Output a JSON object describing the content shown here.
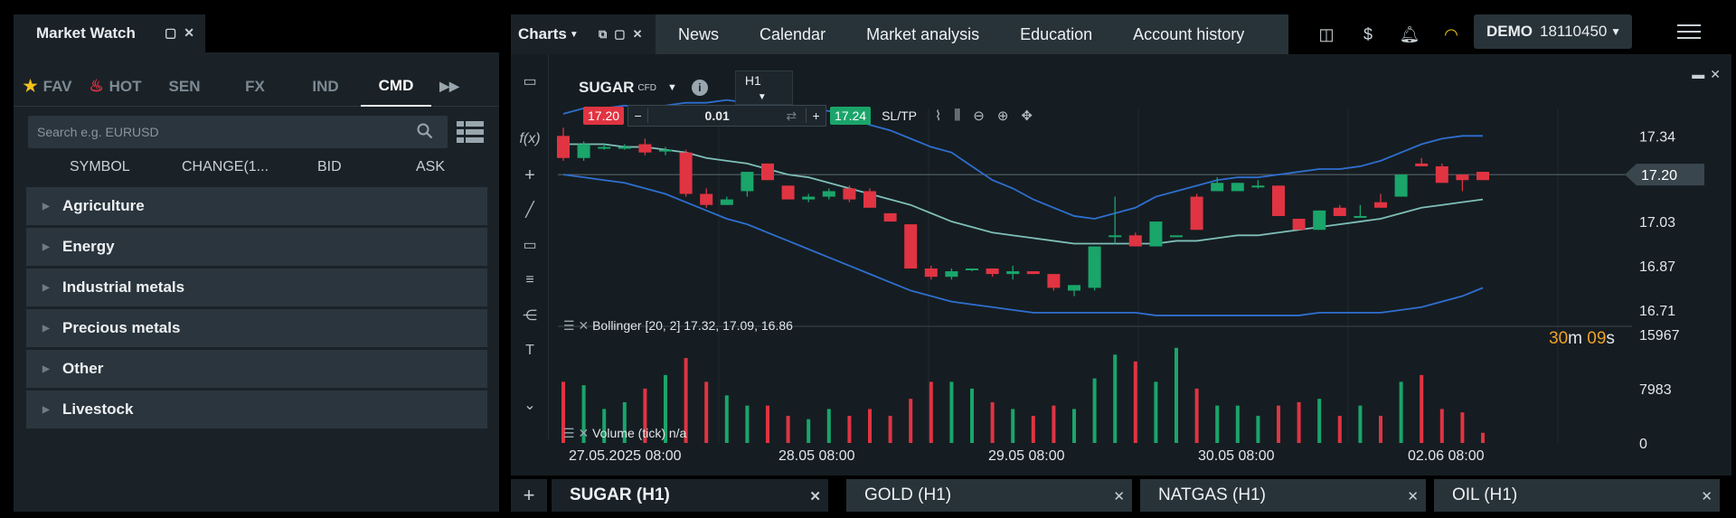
{
  "market_watch": {
    "title": "Market Watch",
    "tabs": [
      {
        "label": "FAV",
        "icon": "star-icon"
      },
      {
        "label": "HOT",
        "icon": "flame-icon"
      },
      {
        "label": "SEN"
      },
      {
        "label": "FX"
      },
      {
        "label": "IND"
      },
      {
        "label": "CMD",
        "active": true
      }
    ],
    "search_placeholder": "Search e.g. EURUSD",
    "columns": [
      "SYMBOL",
      "CHANGE(1...",
      "BID",
      "ASK"
    ],
    "groups": [
      "Agriculture",
      "Energy",
      "Industrial metals",
      "Precious metals",
      "Other",
      "Livestock"
    ]
  },
  "charts": {
    "tab_label": "Charts",
    "nav": [
      "News",
      "Calendar",
      "Market analysis",
      "Education",
      "Account history"
    ],
    "account": {
      "type": "DEMO",
      "number": "18110450"
    },
    "symbol": "SUGAR",
    "symbol_type": "CFD",
    "timeframe": "H1",
    "sell_price": "17.20",
    "buy_price": "17.24",
    "volume": "0.01",
    "sltp_label": "SL/TP",
    "bollinger_label": "Bollinger [20, 2] 17.32, 17.09, 16.86",
    "volume_label": "Volume (tick) n/a",
    "timer": {
      "min": "30",
      "m": "m",
      "sec": "09",
      "s": "s"
    },
    "current_price": "17.20",
    "colors": {
      "bull": "#1aa56a",
      "bear": "#e03442",
      "bb_outer": "#2f6fd0",
      "bb_mid": "#7fbfb8",
      "timer": "#f0a128"
    }
  },
  "chart_data": {
    "type": "candlestick",
    "price_axis_ticks": [
      "17.34",
      "17.20",
      "17.03",
      "16.87",
      "16.71"
    ],
    "volume_axis_ticks": [
      "15967",
      "7983",
      "0"
    ],
    "x_tick_labels": [
      "27.05.2025 08:00",
      "28.05 08:00",
      "29.05 08:00",
      "30.05 08:00",
      "02.06 08:00"
    ],
    "candles": [
      [
        17.34,
        17.37,
        17.25,
        17.26
      ],
      [
        17.26,
        17.32,
        17.25,
        17.31
      ],
      [
        17.3,
        17.31,
        17.29,
        17.3
      ],
      [
        17.3,
        17.31,
        17.29,
        17.3
      ],
      [
        17.31,
        17.33,
        17.27,
        17.28
      ],
      [
        17.29,
        17.3,
        17.27,
        17.29
      ],
      [
        17.28,
        17.29,
        17.12,
        17.13
      ],
      [
        17.13,
        17.15,
        17.08,
        17.09
      ],
      [
        17.09,
        17.12,
        17.09,
        17.11
      ],
      [
        17.14,
        17.21,
        17.12,
        17.21
      ],
      [
        17.24,
        17.24,
        17.18,
        17.18
      ],
      [
        17.16,
        17.16,
        17.11,
        17.11
      ],
      [
        17.11,
        17.13,
        17.1,
        17.12
      ],
      [
        17.12,
        17.15,
        17.11,
        17.14
      ],
      [
        17.15,
        17.16,
        17.1,
        17.11
      ],
      [
        17.14,
        17.15,
        17.08,
        17.08
      ],
      [
        17.06,
        17.06,
        17.03,
        17.03
      ],
      [
        17.02,
        17.02,
        16.86,
        16.86
      ],
      [
        16.86,
        16.87,
        16.82,
        16.83
      ],
      [
        16.83,
        16.86,
        16.82,
        16.85
      ],
      [
        16.86,
        16.86,
        16.85,
        16.86
      ],
      [
        16.86,
        16.86,
        16.83,
        16.84
      ],
      [
        16.84,
        16.87,
        16.82,
        16.85
      ],
      [
        16.85,
        16.85,
        16.84,
        16.84
      ],
      [
        16.84,
        16.84,
        16.78,
        16.79
      ],
      [
        16.78,
        16.8,
        16.76,
        16.8
      ],
      [
        16.79,
        16.94,
        16.78,
        16.94
      ],
      [
        16.98,
        17.12,
        16.95,
        16.98
      ],
      [
        16.98,
        16.99,
        16.94,
        16.94
      ],
      [
        16.94,
        17.03,
        16.94,
        17.03
      ],
      [
        16.98,
        16.98,
        16.98,
        16.98
      ],
      [
        17.12,
        17.13,
        17.0,
        17.0
      ],
      [
        17.14,
        17.19,
        17.14,
        17.17
      ],
      [
        17.14,
        17.17,
        17.14,
        17.17
      ],
      [
        17.16,
        17.18,
        17.15,
        17.16
      ],
      [
        17.16,
        17.16,
        17.05,
        17.05
      ],
      [
        17.04,
        17.04,
        17.0,
        17.0
      ],
      [
        17.0,
        17.07,
        17.0,
        17.07
      ],
      [
        17.08,
        17.09,
        17.05,
        17.05
      ],
      [
        17.05,
        17.09,
        17.05,
        17.05
      ],
      [
        17.1,
        17.13,
        17.08,
        17.08
      ],
      [
        17.12,
        17.2,
        17.12,
        17.2
      ],
      [
        17.24,
        17.26,
        17.23,
        17.23
      ],
      [
        17.23,
        17.24,
        17.17,
        17.17
      ],
      [
        17.2,
        17.2,
        17.14,
        17.18
      ],
      [
        17.21,
        17.21,
        17.18,
        17.18
      ]
    ],
    "volume": [
      9000,
      8500,
      5000,
      6000,
      8000,
      10000,
      12500,
      9000,
      7000,
      5500,
      5500,
      4000,
      3500,
      5000,
      4000,
      5000,
      4000,
      6500,
      9000,
      9000,
      8000,
      6000,
      5000,
      4000,
      5500,
      5000,
      9500,
      13000,
      12000,
      9000,
      14000,
      8000,
      5500,
      5500,
      4000,
      5500,
      6000,
      6500,
      4000,
      5500,
      4000,
      9000,
      10000,
      5000,
      4500,
      1500
    ],
    "bb_upper": [
      17.42,
      17.44,
      17.44,
      17.45,
      17.44,
      17.45,
      17.46,
      17.46,
      17.47,
      17.46,
      17.46,
      17.45,
      17.44,
      17.43,
      17.41,
      17.38,
      17.36,
      17.33,
      17.3,
      17.28,
      17.23,
      17.18,
      17.15,
      17.11,
      17.08,
      17.05,
      17.04,
      17.06,
      17.08,
      17.12,
      17.14,
      17.16,
      17.18,
      17.19,
      17.19,
      17.2,
      17.21,
      17.22,
      17.22,
      17.23,
      17.25,
      17.28,
      17.31,
      17.33,
      17.34,
      17.34
    ],
    "bb_mid": [
      17.31,
      17.31,
      17.31,
      17.3,
      17.3,
      17.29,
      17.28,
      17.26,
      17.25,
      17.24,
      17.22,
      17.2,
      17.19,
      17.17,
      17.15,
      17.13,
      17.11,
      17.09,
      17.06,
      17.03,
      17.01,
      16.99,
      16.98,
      16.97,
      16.96,
      16.95,
      16.95,
      16.95,
      16.95,
      16.95,
      16.96,
      16.96,
      16.97,
      16.98,
      16.98,
      16.99,
      17.0,
      17.01,
      17.02,
      17.03,
      17.04,
      17.06,
      17.08,
      17.09,
      17.1,
      17.11
    ],
    "bb_lower": [
      17.2,
      17.19,
      17.18,
      17.17,
      17.15,
      17.13,
      17.1,
      17.07,
      17.04,
      17.02,
      16.99,
      16.96,
      16.93,
      16.9,
      16.87,
      16.84,
      16.81,
      16.78,
      16.76,
      16.74,
      16.73,
      16.72,
      16.71,
      16.7,
      16.7,
      16.7,
      16.7,
      16.7,
      16.7,
      16.69,
      16.69,
      16.69,
      16.69,
      16.69,
      16.69,
      16.69,
      16.69,
      16.7,
      16.7,
      16.7,
      16.7,
      16.71,
      16.72,
      16.74,
      16.76,
      16.79
    ]
  },
  "bottom_tabs": [
    {
      "label": "SUGAR (H1)",
      "active": true
    },
    {
      "label": "GOLD (H1)"
    },
    {
      "label": "NATGAS (H1)"
    },
    {
      "label": "OIL (H1)"
    }
  ]
}
